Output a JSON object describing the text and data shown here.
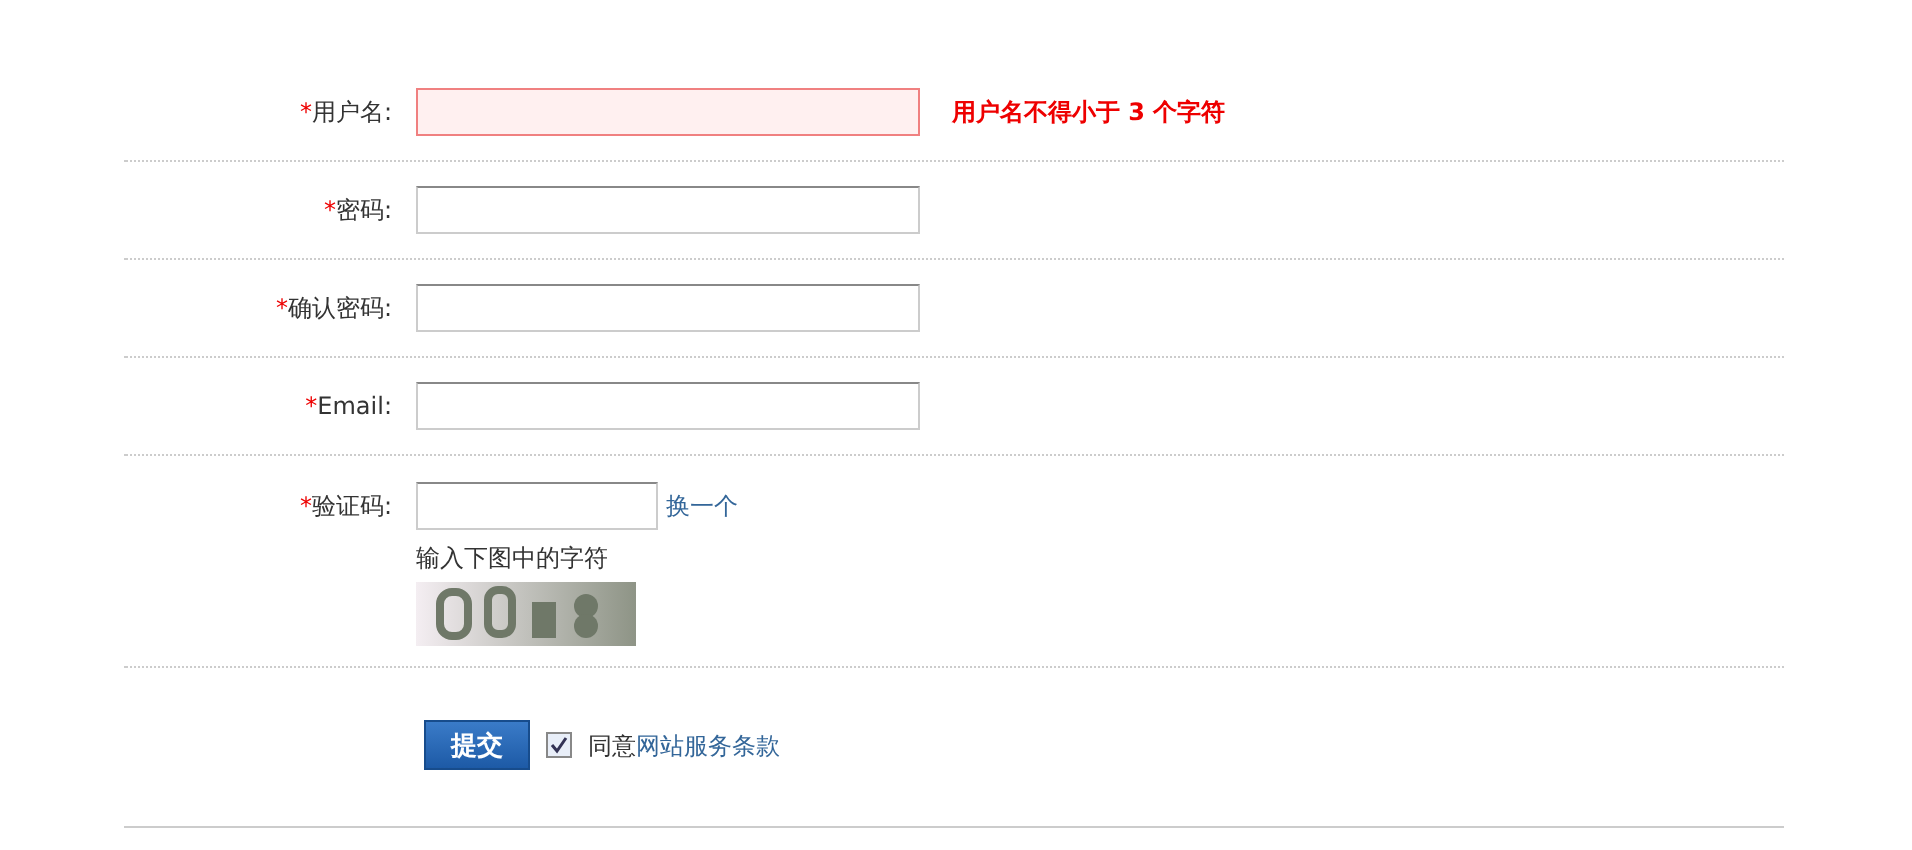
{
  "fields": [
    {
      "kind": "text",
      "required_mark": "*",
      "label": "用户名:",
      "error": true,
      "message": "用户名不得小于 3 个字符"
    },
    {
      "kind": "text",
      "required_mark": "*",
      "label": "密码:",
      "error": false
    },
    {
      "kind": "text",
      "required_mark": "*",
      "label": "确认密码:",
      "error": false
    },
    {
      "kind": "text",
      "required_mark": "*",
      "label": "Email:",
      "error": false
    },
    {
      "kind": "captcha",
      "required_mark": "*",
      "label": "验证码:",
      "error": false,
      "refresh_link": "换一个",
      "hint": "输入下图中的字符"
    }
  ],
  "submit": {
    "label": "提交"
  },
  "agree": {
    "checked": true,
    "text": "同意",
    "link": "网站服务条款"
  }
}
